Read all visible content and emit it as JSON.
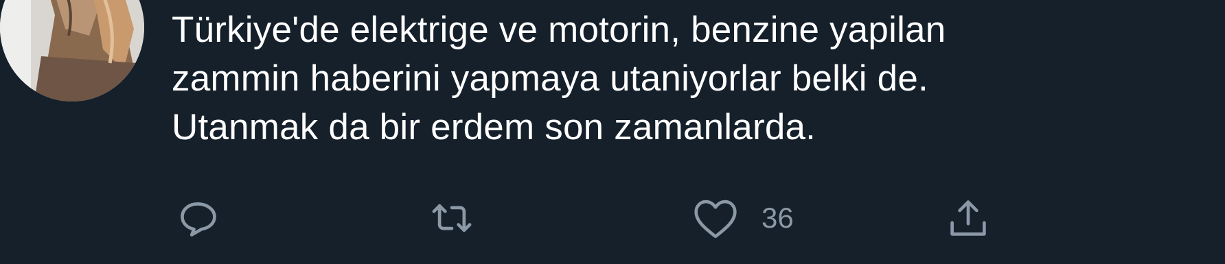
{
  "tweet": {
    "avatar_icon": "user-avatar-photo",
    "text_lines": [
      "Türkiye'de elektrige ve motorin, benzine yapilan",
      "zammin haberini yapmaya utaniyorlar belki de.",
      "Utanmak da bir erdem son zamanlarda."
    ]
  },
  "actions": {
    "reply": {
      "icon": "reply-icon"
    },
    "retweet": {
      "icon": "retweet-icon"
    },
    "like": {
      "icon": "heart-icon",
      "count": "36"
    },
    "share": {
      "icon": "share-icon"
    }
  },
  "colors": {
    "background": "#15202b",
    "text": "#ffffff",
    "icon": "#8b98a5"
  }
}
